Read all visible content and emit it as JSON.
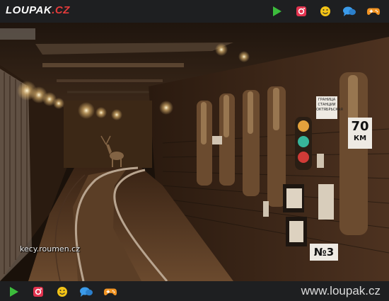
{
  "brand": {
    "logo_text": "LOUPAK",
    "logo_dot": ".",
    "logo_tld": "CZ"
  },
  "topbar": {
    "icons": [
      "play-icon",
      "instagram-icon",
      "smiley-icon",
      "chat-bubbles-icon",
      "gamepad-icon"
    ]
  },
  "photo": {
    "watermark": "kecy.roumen.cz",
    "signs": {
      "station_border": "ГРАНИЦА СТАНЦИИ ОКТЯБРЬСКАЯ",
      "speed_value": "70",
      "speed_unit": "КМ",
      "track_number": "№3"
    }
  },
  "bottombar": {
    "site_url": "www.loupak.cz"
  },
  "colors": {
    "bar_bg": "#1e1f21",
    "play": "#3cbc3c",
    "instagram": "#e2334f",
    "smiley": "#f3c316",
    "chat": "#3b9bea",
    "gamepad": "#f39422"
  }
}
